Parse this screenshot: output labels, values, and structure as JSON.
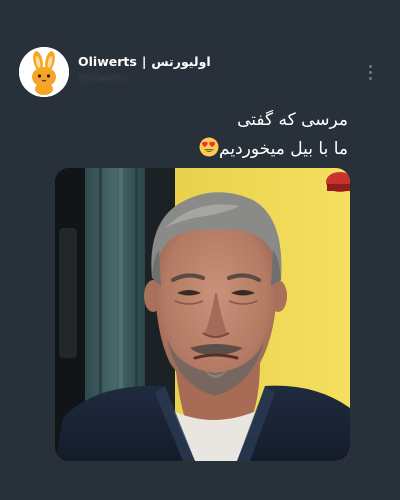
{
  "tweet": {
    "author_name_latin": "Oliwerts",
    "author_separator": "|",
    "author_name_persian": "اولیورتس",
    "author_handle": "@oliwerts",
    "text_line_1": "مرسی که گفتی",
    "text_line_2": "ما با بیل میخوردیم",
    "text_emoji": "heart-eyes-emoji"
  },
  "icons": {
    "avatar": "orange-rabbit-icon",
    "more": "vertical-ellipsis-icon",
    "emoji": "smiling-face-with-heart-eyes-icon"
  },
  "media": {
    "type": "photo"
  },
  "colors": {
    "background": "#283039",
    "text": "#ffffff",
    "rabbit": "#f5a623",
    "emoji_face": "#ffcc4d",
    "emoji_heart": "#e8304a"
  }
}
